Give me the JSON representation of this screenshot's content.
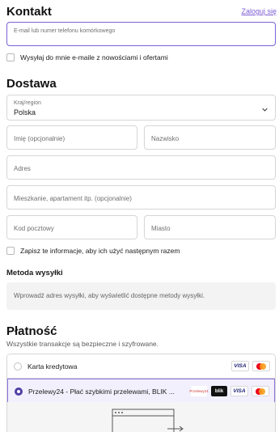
{
  "contact": {
    "title": "Kontakt",
    "login_link": "Zaloguj się",
    "email_placeholder": "E-mail lub numer telefonu komórkowego",
    "newsletter_label": "Wysyłaj do mnie e-maile z nowościami i ofertami"
  },
  "delivery": {
    "title": "Dostawa",
    "country_label": "Kraj/region",
    "country_value": "Polska",
    "first_name": "Imię (opcjonalnie)",
    "last_name": "Nazwisko",
    "address": "Adres",
    "apartment": "Mieszkanie, apartament itp. (opcjonalnie)",
    "postal_code": "Kod pocztowy",
    "city": "Miasto",
    "save_info_label": "Zapisz te informacje, aby ich użyć następnym razem"
  },
  "shipping": {
    "title": "Metoda wysyłki",
    "info": "Wprowadź adres wysyłki, aby wyświetlić dostępne metody wysyłki."
  },
  "payment": {
    "title": "Płatność",
    "secure_note": "Wszystkie transakcje są bezpieczne i szyfrowane.",
    "options": [
      {
        "label": "Karta kredytowa",
        "selected": false
      },
      {
        "label": "Przelewy24 - Płać szybkimi przelewami, BLIK ...",
        "selected": true
      }
    ],
    "badges": {
      "visa": "VISA",
      "blik": "blik",
      "p24": "Przelewy24"
    }
  },
  "colors": {
    "accent": "#7b61d9",
    "radio_selected": "#4f3fa6"
  }
}
